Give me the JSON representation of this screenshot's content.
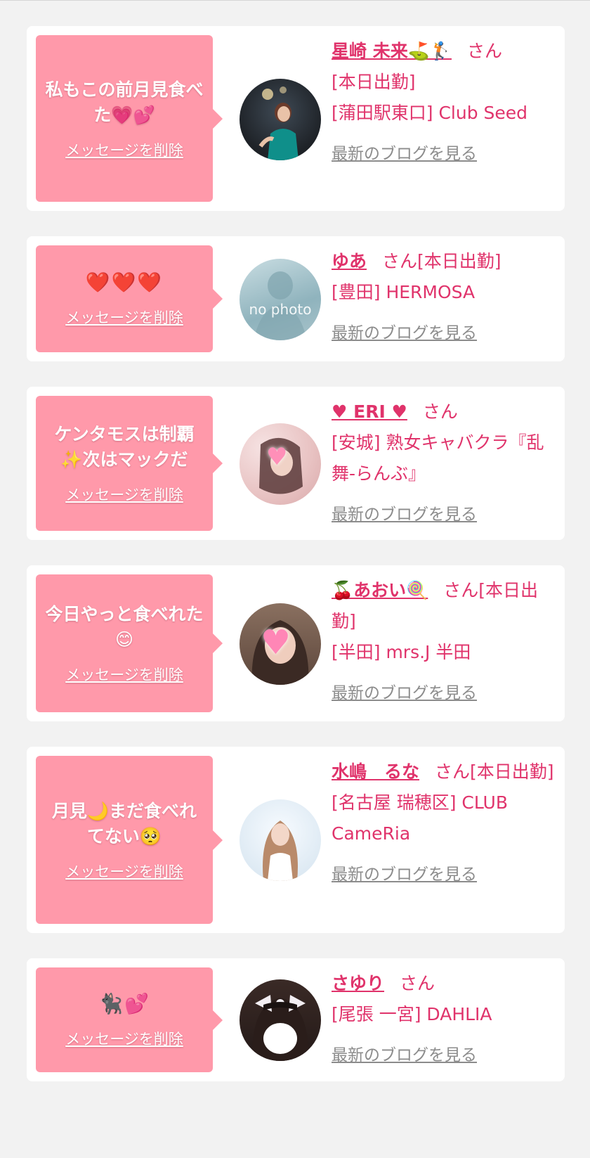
{
  "delete_label": "メッセージを削除",
  "latest_blog_label": "最新のブログを見る",
  "colors": {
    "bubble": "#ff99aa",
    "accent": "#e0336b",
    "link_gray": "#8c8c8c",
    "background": "#f2f2f2"
  },
  "messages": [
    {
      "text": "私もこの前月見食べた💗💕",
      "name": "星崎 未来⛳🏌",
      "suffix": "さん",
      "status": "[本日出勤]",
      "shop": "[蒲田駅東口] Club Seed"
    },
    {
      "text": "❤️❤️❤️",
      "name": "ゆあ",
      "suffix": "さん[本日出勤]",
      "status": "",
      "shop": "[豊田] HERMOSA",
      "avatar_text": "no photo"
    },
    {
      "text": "ケンタモスは制覇✨次はマックだ",
      "name": "♥ ERI ♥",
      "suffix": "さん",
      "status": "",
      "shop": "[安城] 熟女キャバクラ『乱舞-らんぶ』"
    },
    {
      "text": "今日やっと食べれた😊",
      "name": "🍒あおい🍭",
      "suffix": "さん[本日出勤]",
      "status": "",
      "shop": "[半田] mrs.J 半田"
    },
    {
      "text": "月見🌙まだ食べれてない🥺",
      "name": "水嶋　るな",
      "suffix": "さん[本日出勤]",
      "status": "",
      "shop": "[名古屋 瑞穂区] CLUB CameRia"
    },
    {
      "text": "🐈‍⬛💕",
      "name": "さゆり",
      "suffix": "さん",
      "status": "",
      "shop": "[尾張 一宮] DAHLIA"
    }
  ]
}
